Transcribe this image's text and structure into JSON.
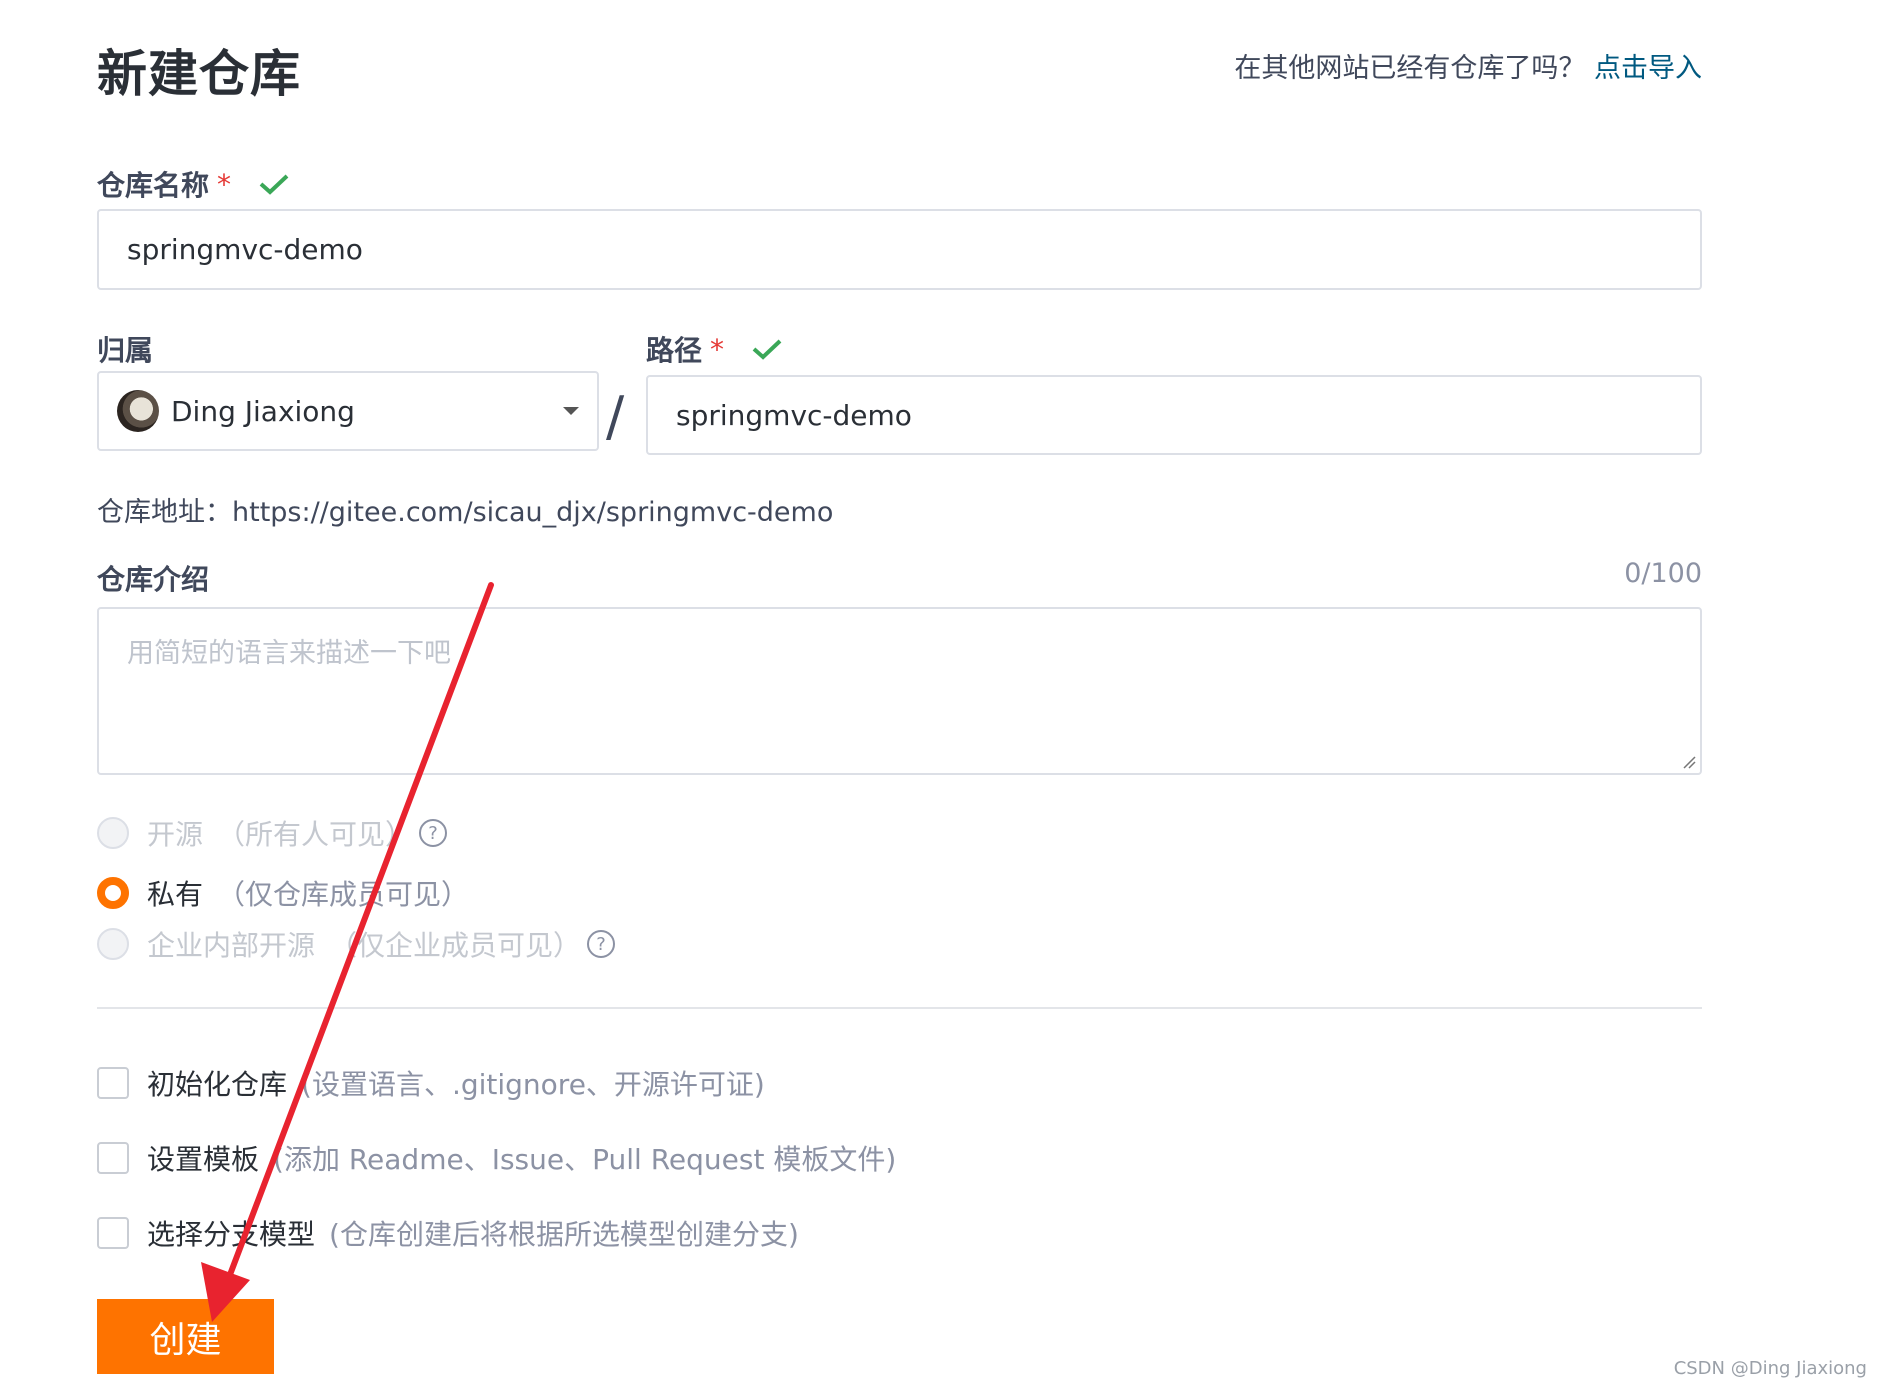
{
  "header": {
    "title": "新建仓库",
    "import_hint": "在其他网站已经有仓库了吗？",
    "import_link": "点击导入"
  },
  "form": {
    "repo_name": {
      "label": "仓库名称",
      "required_mark": "*",
      "value": "springmvc-demo",
      "valid": true
    },
    "owner": {
      "label": "归属",
      "value": "Ding Jiaxiong"
    },
    "separator": "/",
    "path": {
      "label": "路径",
      "required_mark": "*",
      "value": "springmvc-demo",
      "valid": true
    },
    "repo_url": {
      "label": "仓库地址：",
      "value": "https://gitee.com/sicau_djx/springmvc-demo"
    },
    "description": {
      "label": "仓库介绍",
      "counter": "0/100",
      "placeholder": "用简短的语言来描述一下吧",
      "value": ""
    }
  },
  "visibility": [
    {
      "label": "开源",
      "desc": "（所有人可见）",
      "checked": false,
      "disabled": true,
      "help": "?"
    },
    {
      "label": "私有",
      "desc": "（仅仓库成员可见）",
      "checked": true,
      "disabled": false
    },
    {
      "label": "企业内部开源",
      "desc": "（仅企业成员可见）",
      "checked": false,
      "disabled": true,
      "help": "?"
    }
  ],
  "options": [
    {
      "label": "初始化仓库",
      "desc": "(设置语言、.gitignore、开源许可证)",
      "checked": false
    },
    {
      "label": "设置模板",
      "desc": "(添加 Readme、Issue、Pull Request 模板文件)",
      "checked": false
    },
    {
      "label": "选择分支模型",
      "desc": "(仓库创建后将根据所选模型创建分支)",
      "checked": false
    }
  ],
  "submit_label": "创建",
  "watermark": "CSDN @Ding Jiaxiong",
  "colors": {
    "accent": "#fe7300",
    "link": "#005980",
    "valid": "#3aa757",
    "annotation_arrow": "#e8232f"
  }
}
